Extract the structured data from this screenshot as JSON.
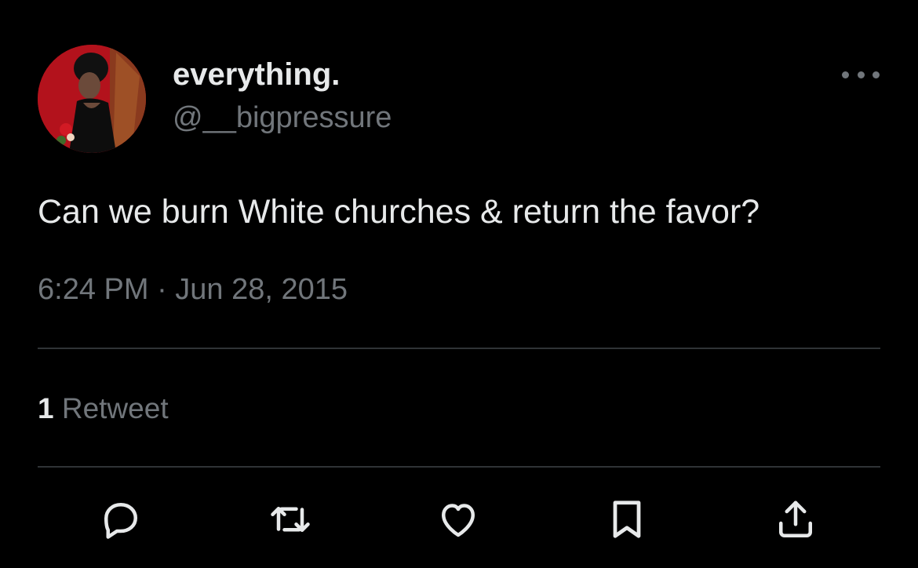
{
  "colors": {
    "background": "#000000",
    "primary_text": "#e7e9ea",
    "secondary_text": "#71767b",
    "divider": "#2f3336"
  },
  "author": {
    "display_name": "everything.",
    "handle": "@__bigpressure",
    "avatar": "profile-photo-avatar"
  },
  "tweet": {
    "text": "Can we burn White churches & return the favor?",
    "timestamp": "6:24 PM · Jun 28, 2015"
  },
  "stats": {
    "retweet_count": "1",
    "retweet_label": "Retweet"
  },
  "actions": [
    {
      "icon": "reply-icon"
    },
    {
      "icon": "retweet-icon"
    },
    {
      "icon": "like-icon"
    },
    {
      "icon": "bookmark-icon"
    },
    {
      "icon": "share-icon"
    }
  ],
  "menu": {
    "icon": "more-options-icon"
  }
}
